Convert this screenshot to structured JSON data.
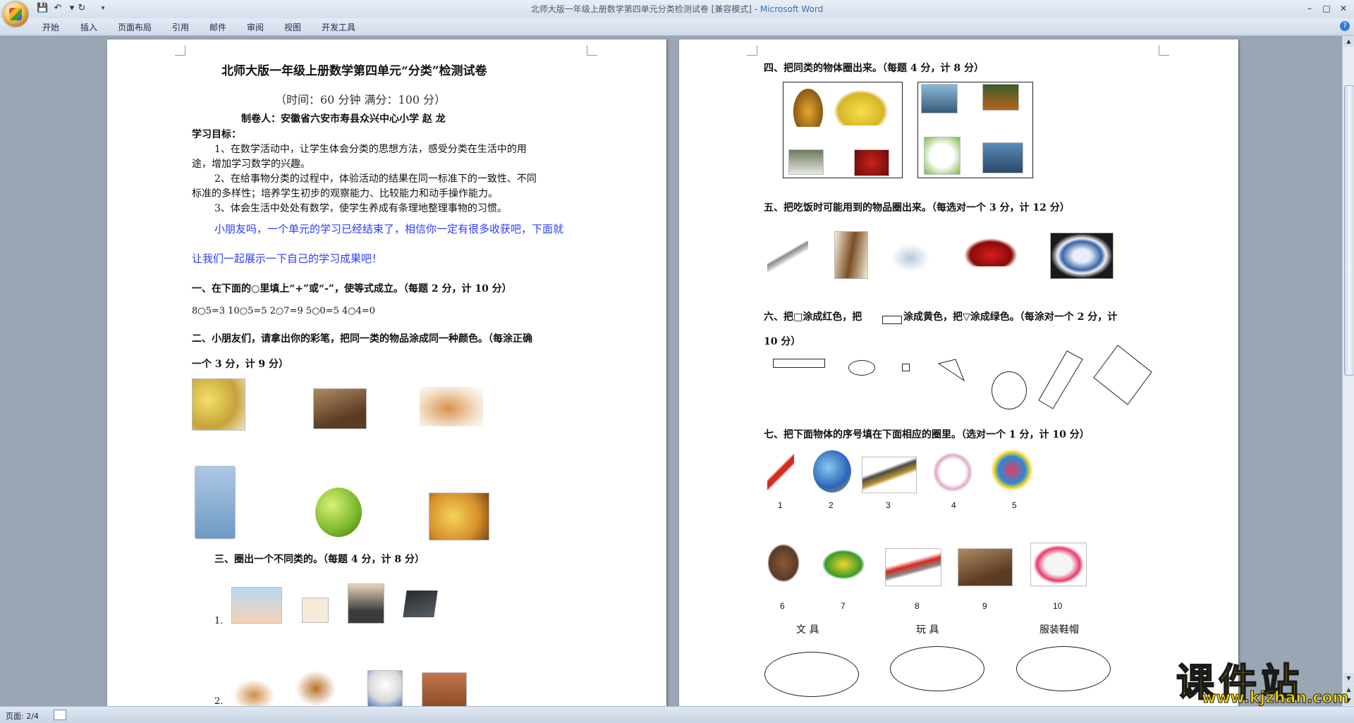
{
  "window": {
    "title": "北师大版一年级上册数学第四单元分类检测试卷 [兼容模式] - ",
    "app_name": "Microsoft Word",
    "quick_access": [
      "save-icon",
      "undo-icon",
      "redo-icon",
      "customize-icon"
    ]
  },
  "ribbon": {
    "tabs": [
      "开始",
      "插入",
      "页面布局",
      "引用",
      "邮件",
      "审阅",
      "视图",
      "开发工具"
    ]
  },
  "doc_left": {
    "title": "北师大版一年级上册数学第四单元“分类”检测试卷",
    "subtitle": "（时间：60 分钟   满分：100 分）",
    "author": "制卷人：安徽省六安市寿县众兴中心小学      赵    龙",
    "goals_heading": "学习目标：",
    "goal1_a": "1、在数学活动中，让学生体会分类的思想方法，感受分类在生活中的用",
    "goal1_b": "途，增加学习数学的兴趣。",
    "goal2_a": "2、在给事物分类的过程中，体验活动的结果在同一标准下的一致性、不同",
    "goal2_b": "标准的多样性；培养学生初步的观察能力、比较能力和动手操作能力。",
    "goal3": "3、体会生活中处处有数学，使学生养成有条理地整理事物的习惯。",
    "intro_a": "小朋友吗，一个单元的学习已经结束了，相信你一定有很多收获吧，下面就",
    "intro_b": "让我们一起展示一下自己的学习成果吧！",
    "q1_title": "一、在下面的○里填上“+”或“-”，使等式成立。（每题 2 分，计 10 分）",
    "q1_items": "8○5=3   10○5=5    2○7=9    5○0=5    4○4=0",
    "q2_title_a": "二、小朋友们，请拿出你的彩笔，把同一类的物品涂成同一种颜色。（每涂正确",
    "q2_title_b": "一个 3 分，计 9 分）",
    "q3_title": "三、圈出一个不同类的。（每题 4 分，计 8 分）",
    "q3_n1": "1.",
    "q3_n2": "2."
  },
  "doc_right": {
    "q4_title": "四、把同类的物体圈出来。（每题 4 分，计 8 分）",
    "q5_title": "五、把吃饭时可能用到的物品圈出来。（每选对一个 3 分，计 12 分）",
    "q6_title_a": "六、把□涂成红色，把",
    "q6_title_b": "涂成黄色，把▽涂成绿色。（每涂对一个 2 分，计",
    "q6_title_c": "10 分）",
    "q7_title": "七、把下面物体的序号填在下面相应的圈里。（选对一个 1 分，计 10 分）",
    "q7_numbers_row1": [
      "1",
      "2",
      "3",
      "4",
      "5"
    ],
    "q7_numbers_row2": [
      "6",
      "7",
      "8",
      "9",
      "10"
    ],
    "cat_stationery": "文  具",
    "cat_toys": "玩  具",
    "cat_clothing": "服装鞋帽"
  },
  "status": {
    "page": "页面: 2/4"
  },
  "watermark": {
    "main": "课件站",
    "url": "www.kjzhan.com"
  },
  "colors": {
    "accent_blue": "#2b3cff",
    "watermark_yellow": "#f3d200"
  }
}
